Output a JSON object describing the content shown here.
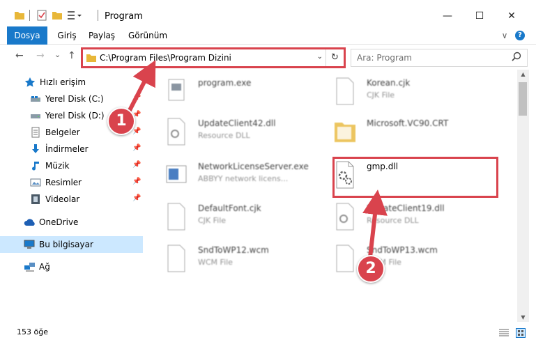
{
  "window": {
    "title": "Program",
    "minimize_glyph": "—",
    "maximize_glyph": "☐",
    "close_glyph": "✕"
  },
  "ribbon": {
    "tabs": [
      "Dosya",
      "Giriş",
      "Paylaş",
      "Görünüm"
    ],
    "collapse_glyph": "∨",
    "help_glyph": "?"
  },
  "nav": {
    "back_glyph": "←",
    "forward_glyph": "→",
    "recent_glyph": "⌄",
    "up_glyph": "↑"
  },
  "address": {
    "path": "C:\\Program Files\\Program Dizini",
    "refresh_glyph": "↻",
    "dropdown_glyph": "⌄"
  },
  "search": {
    "placeholder": "Ara: Program",
    "icon": "search-icon"
  },
  "sidebar": {
    "items": [
      {
        "label": "Hızlı erişim",
        "icon": "star-icon"
      },
      {
        "label": "Yerel Disk (C:)",
        "icon": "drive-icon",
        "pinned": true
      },
      {
        "label": "Yerel Disk (D:)",
        "icon": "drive-icon",
        "pinned": true
      },
      {
        "label": "Belgeler",
        "icon": "documents-icon",
        "pinned": true
      },
      {
        "label": "İndirmeler",
        "icon": "downloads-icon",
        "pinned": true
      },
      {
        "label": "Müzik",
        "icon": "music-icon",
        "pinned": true
      },
      {
        "label": "Resimler",
        "icon": "pictures-icon",
        "pinned": true
      },
      {
        "label": "Videolar",
        "icon": "videos-icon",
        "pinned": true
      },
      {
        "label": "OneDrive",
        "icon": "cloud-icon"
      },
      {
        "label": "Bu bilgisayar",
        "icon": "computer-icon",
        "selected": true
      },
      {
        "label": "Ağ",
        "icon": "network-icon"
      }
    ]
  },
  "files": [
    {
      "name": "program.exe",
      "type": "",
      "icon": "exe-icon"
    },
    {
      "name": "Korean.cjk",
      "type": "CJK File",
      "icon": "file-icon"
    },
    {
      "name": "UpdateClient42.dll",
      "type": "Resource DLL",
      "icon": "dll-icon"
    },
    {
      "name": "Microsoft.VC90.CRT",
      "type": "",
      "icon": "folder-icon"
    },
    {
      "name": "NetworkLicenseServer.exe",
      "type": "ABBYY network licens...",
      "icon": "exe-icon"
    },
    {
      "name": "gmp.dll",
      "type": "",
      "icon": "dll-icon"
    },
    {
      "name": "DefaultFont.cjk",
      "type": "CJK File",
      "icon": "file-icon"
    },
    {
      "name": "UpdateClient19.dll",
      "type": "Resource DLL",
      "icon": "dll-icon"
    },
    {
      "name": "SndToWP12.wcm",
      "type": "WCM File",
      "icon": "file-icon"
    },
    {
      "name": "SndToWP13.wcm",
      "type": "WCM File",
      "icon": "file-icon"
    }
  ],
  "status": {
    "count": "153 öğe"
  },
  "annotations": {
    "step1": "1",
    "step2": "2",
    "color": "#d9434d"
  },
  "colors": {
    "file_tab": "#1979ca",
    "selected_nav": "#cce8ff",
    "folder": "#e8b739"
  }
}
